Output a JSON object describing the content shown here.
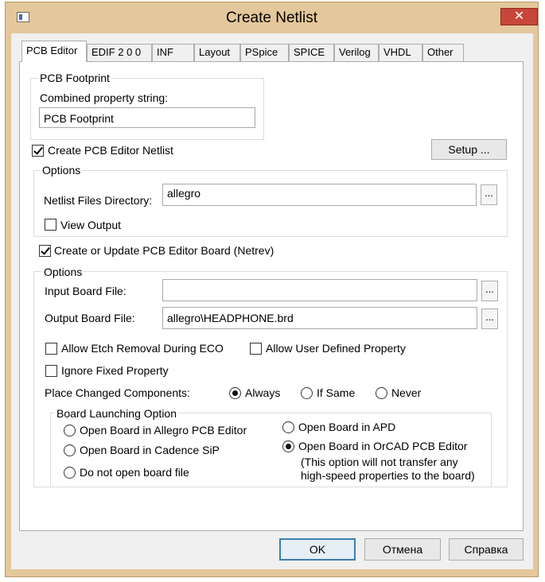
{
  "window": {
    "title": "Create Netlist",
    "close_symbol": "✕"
  },
  "tabs": [
    {
      "label": "PCB Editor",
      "active": true
    },
    {
      "label": "EDIF 2 0 0"
    },
    {
      "label": "INF"
    },
    {
      "label": "Layout"
    },
    {
      "label": "PSpice"
    },
    {
      "label": "SPICE"
    },
    {
      "label": "Verilog"
    },
    {
      "label": "VHDL"
    },
    {
      "label": "Other"
    }
  ],
  "pcb_footprint": {
    "group_label": "PCB Footprint",
    "field_label": "Combined property string:",
    "value": "PCB Footprint"
  },
  "create_netlist": {
    "label": "Create PCB Editor Netlist",
    "checked": true
  },
  "setup_button": "Setup ...",
  "netlist_options": {
    "group_label": "Options",
    "dir_label": "Netlist Files Directory:",
    "dir_value": "allegro",
    "browse": "...",
    "view_output_label": "View Output",
    "view_output_checked": false
  },
  "create_board": {
    "label": "Create or Update PCB Editor Board (Netrev)",
    "checked": true
  },
  "board_options": {
    "group_label": "Options",
    "input_label": "Input Board File:",
    "input_value": "",
    "output_label": "Output Board File:",
    "output_value": "allegro\\HEADPHONE.brd",
    "browse": "...",
    "allow_etch_label": "Allow Etch Removal During ECO",
    "allow_user_label": "Allow User Defined Property",
    "ignore_fixed_label": "Ignore Fixed Property",
    "place_changed_label": "Place Changed Components:",
    "place_options": [
      "Always",
      "If Same",
      "Never"
    ],
    "place_selected": "Always"
  },
  "board_launching": {
    "group_label": "Board Launching Option",
    "options": [
      "Open Board in Allegro PCB Editor",
      "Open Board in Cadence SiP",
      "Do not open board file",
      "Open Board in APD",
      "Open Board in OrCAD PCB Editor"
    ],
    "selected": "Open Board in OrCAD PCB Editor",
    "note_line1": "(This option will not transfer any",
    "note_line2": "high-speed properties to the board)"
  },
  "buttons": {
    "ok": "OK",
    "cancel": "Отмена",
    "help": "Справка"
  }
}
